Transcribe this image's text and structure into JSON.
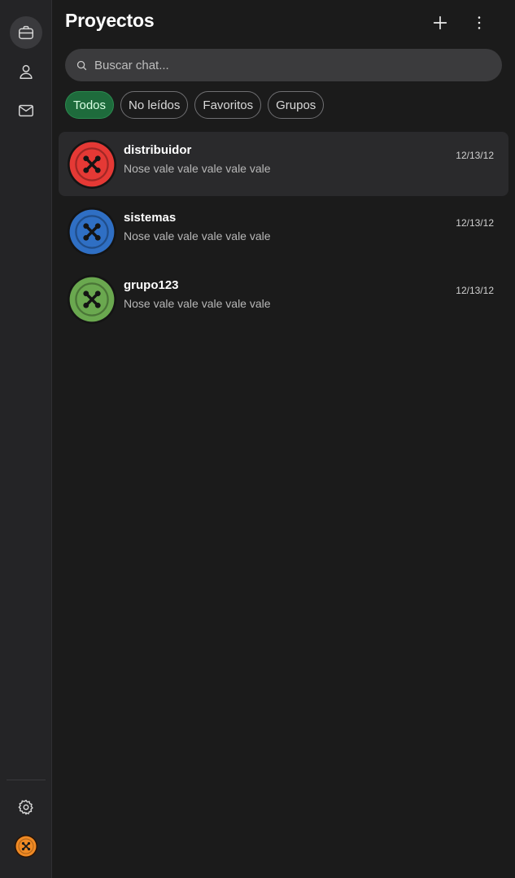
{
  "header": {
    "title": "Proyectos"
  },
  "search": {
    "placeholder": "Buscar chat..."
  },
  "filters": [
    {
      "label": "Todos",
      "active": true
    },
    {
      "label": "No leídos",
      "active": false
    },
    {
      "label": "Favoritos",
      "active": false
    },
    {
      "label": "Grupos",
      "active": false
    }
  ],
  "rail": {
    "icons": [
      "briefcase-icon",
      "user-icon",
      "mail-icon",
      "gear-icon"
    ]
  },
  "chats": [
    {
      "name": "distribuidor",
      "preview": "Nose vale vale vale vale vale",
      "date": "12/13/12",
      "color": "#e53935",
      "selected": true
    },
    {
      "name": "sistemas",
      "preview": "Nose vale vale vale vale vale",
      "date": "12/13/12",
      "color": "#2f6fc4",
      "selected": false
    },
    {
      "name": "grupo123",
      "preview": "Nose vale vale vale vale vale",
      "date": "12/13/12",
      "color": "#6aa84f",
      "selected": false
    }
  ],
  "colors": {
    "accent": "#1e6b3c",
    "user_avatar": "#f08a24"
  }
}
